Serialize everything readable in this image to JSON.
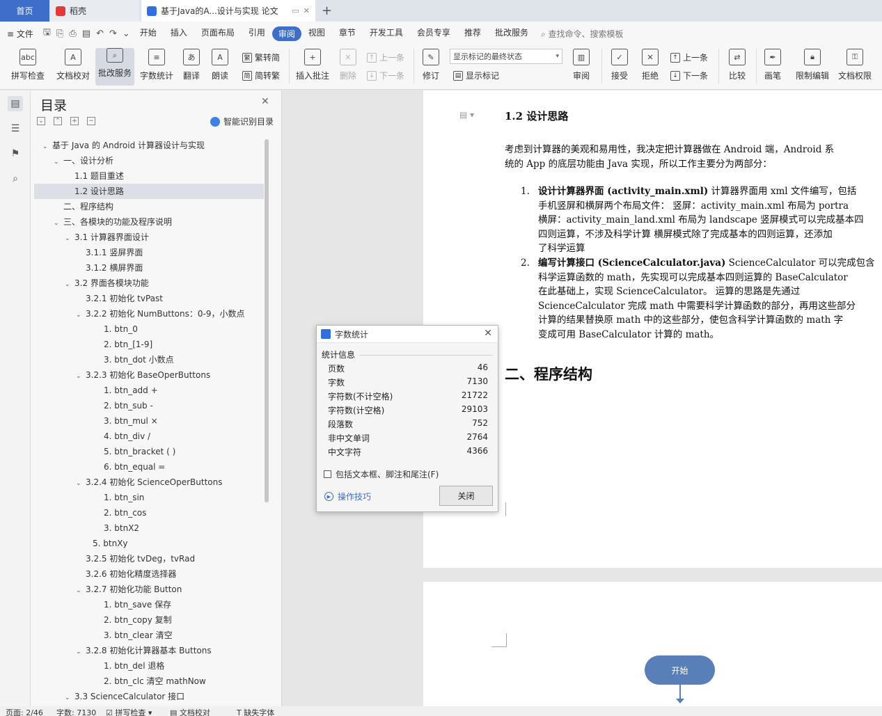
{
  "tabs": {
    "home": "首页",
    "daoke": "稻壳",
    "doc": "基于Java的A...设计与实现 论文"
  },
  "menu": {
    "file": "文件",
    "items": [
      "开始",
      "插入",
      "页面布局",
      "引用",
      "审阅",
      "视图",
      "章节",
      "开发工具",
      "会员专享",
      "推荐",
      "批改服务"
    ],
    "active_index": 4,
    "search": "查找命令、搜索模板"
  },
  "ribbon": {
    "spell": "拼写检查",
    "proof": "文档校对",
    "correct": "批改服务",
    "wordcount": "字数统计",
    "translate": "翻译",
    "read": "朗读",
    "to_trad": "繁转简",
    "to_simp": "简转繁",
    "insert_comment": "插入批注",
    "delete": "删除",
    "prev_comment": "上一条",
    "next_comment": "下一条",
    "revise": "修订",
    "markup_state": "显示标记的最终状态",
    "show_markup": "显示标记",
    "review": "审阅",
    "accept": "接受",
    "reject": "拒绝",
    "prev_change": "上一条",
    "next_change": "下一条",
    "compare": "比较",
    "pen": "画笔",
    "restrict": "限制编辑",
    "perm": "文档权限"
  },
  "toc": {
    "title": "目录",
    "smart": "智能识别目录",
    "items": [
      {
        "text": "基于 Java 的 Android 计算器设计与实现",
        "level": 0,
        "arrow": true
      },
      {
        "text": "一、设计分析",
        "level": 1,
        "arrow": true
      },
      {
        "text": "1.1  题目重述",
        "level": 2,
        "arrow": false
      },
      {
        "text": "1.2  设计思路",
        "level": 2,
        "arrow": false,
        "selected": true
      },
      {
        "text": "二、程序结构",
        "level": 1,
        "arrow": false
      },
      {
        "text": "三、各模块的功能及程序说明",
        "level": 1,
        "arrow": true
      },
      {
        "text": "3.1  计算器界面设计",
        "level": 2,
        "arrow": true
      },
      {
        "text": "3.1.1  竖屏界面",
        "level": 3,
        "arrow": false
      },
      {
        "text": "3.1.2  横屏界面",
        "level": 3,
        "arrow": false
      },
      {
        "text": "3.2  界面各模块功能",
        "level": 2,
        "arrow": true
      },
      {
        "text": "3.2.1  初始化  tvPast",
        "level": 3,
        "arrow": false
      },
      {
        "text": "3.2.2  初始化  NumButtons：0-9，小数点",
        "level": 3,
        "arrow": true
      },
      {
        "text": "1. btn_0",
        "level": 4,
        "arrow": false
      },
      {
        "text": "2. btn_[1-9]",
        "level": 4,
        "arrow": false
      },
      {
        "text": "3. btn_dot  小数点",
        "level": 4,
        "arrow": false
      },
      {
        "text": "3.2.3  初始化  BaseOperButtons",
        "level": 3,
        "arrow": true
      },
      {
        "text": "1. btn_add  +",
        "level": 4,
        "arrow": false
      },
      {
        "text": "2. btn_sub  -",
        "level": 4,
        "arrow": false
      },
      {
        "text": "3. btn_mul  ×",
        "level": 4,
        "arrow": false
      },
      {
        "text": "4. btn_div  /",
        "level": 4,
        "arrow": false
      },
      {
        "text": "5. btn_bracket  ( )",
        "level": 4,
        "arrow": false
      },
      {
        "text": "6. btn_equal  =",
        "level": 4,
        "arrow": false
      },
      {
        "text": "3.2.4  初始化  ScienceOperButtons",
        "level": 3,
        "arrow": true
      },
      {
        "text": "1. btn_sin",
        "level": 4,
        "arrow": false
      },
      {
        "text": "2. btn_cos",
        "level": 4,
        "arrow": false
      },
      {
        "text": "3. btnX2",
        "level": 4,
        "arrow": false
      },
      {
        "text": "5. btnXy",
        "level": 3.5,
        "arrow": false
      },
      {
        "text": "3.2.5  初始化  tvDeg，tvRad",
        "level": 3,
        "arrow": false
      },
      {
        "text": "3.2.6  初始化精度选择器",
        "level": 3,
        "arrow": false
      },
      {
        "text": "3.2.7  初始化功能  Button",
        "level": 3,
        "arrow": true
      },
      {
        "text": "1. btn_save  保存",
        "level": 4,
        "arrow": false
      },
      {
        "text": "2. btn_copy  复制",
        "level": 4,
        "arrow": false
      },
      {
        "text": "3. btn_clear  清空",
        "level": 4,
        "arrow": false
      },
      {
        "text": "3.2.8  初始化计算器基本 Buttons",
        "level": 3,
        "arrow": true
      },
      {
        "text": "1. btn_del  退格",
        "level": 4,
        "arrow": false
      },
      {
        "text": "2. btn_clc  清空 mathNow",
        "level": 4,
        "arrow": false
      },
      {
        "text": "3.3 ScienceCalculator 接口",
        "level": 2,
        "arrow": true
      }
    ]
  },
  "doc": {
    "h12": "1.2  设计思路",
    "intro1": "考虑到计算器的美观和易用性，我决定把计算器做在 Android 端，Android 系",
    "intro2": "统的 App 的底层功能由 Java 实现，所以工作主要分为两部分：",
    "item1": {
      "num": "1.",
      "bold": "设计计算器界面 (activity_main.xml)",
      "l1": " 计算器界面用 xml 文件编写，包括",
      "l2": "手机竖屏和横屏两个布局文件： 竖屏：activity_main.xml 布局为 portra",
      "l3": "横屏：activity_main_land.xml 布局为 landscape 竖屏模式可以完成基本四",
      "l4": "四则运算，不涉及科学计算 横屏模式除了完成基本的四则运算，还添加",
      "l5": "了科学运算"
    },
    "item2": {
      "num": "2.",
      "bold": "编写计算接口 (ScienceCalculator.java)",
      "l1": " ScienceCalculator 可以完成包含",
      "l2": "科学运算函数的 math，先实现可以完成基本四则运算的 BaseCalculator",
      "l3": "在此基础上，实现 ScienceCalculator。 运算的思路是先通过",
      "l4": "ScienceCalculator 完成 math 中需要科学计算函数的部分，再用这些部分",
      "l5": "计算的结果替换原 math 中的这些部分，使包含科学计算函数的 math 字",
      "l6": "变成可用 BaseCalculator 计算的 math。"
    },
    "h2": "二、程序结构",
    "flow_start": "开始"
  },
  "dialog": {
    "title": "字数统计",
    "group": "统计信息",
    "rows": [
      {
        "label": "页数",
        "value": "46"
      },
      {
        "label": "字数",
        "value": "7130"
      },
      {
        "label": "字符数(不计空格)",
        "value": "21722"
      },
      {
        "label": "字符数(计空格)",
        "value": "29103"
      },
      {
        "label": "段落数",
        "value": "752"
      },
      {
        "label": "非中文单词",
        "value": "2764"
      },
      {
        "label": "中文字符",
        "value": "4366"
      }
    ],
    "checkbox": "包括文本框、脚注和尾注(F)",
    "tips": "操作技巧",
    "close": "关闭"
  },
  "status": {
    "page": "页面: 2/46",
    "words": "字数: 7130",
    "spell": "拼写检查",
    "proof": "文档校对",
    "missing_font": "缺失字体"
  },
  "colors": {
    "accent": "#3e6ec9",
    "flow": "#587fb8"
  }
}
